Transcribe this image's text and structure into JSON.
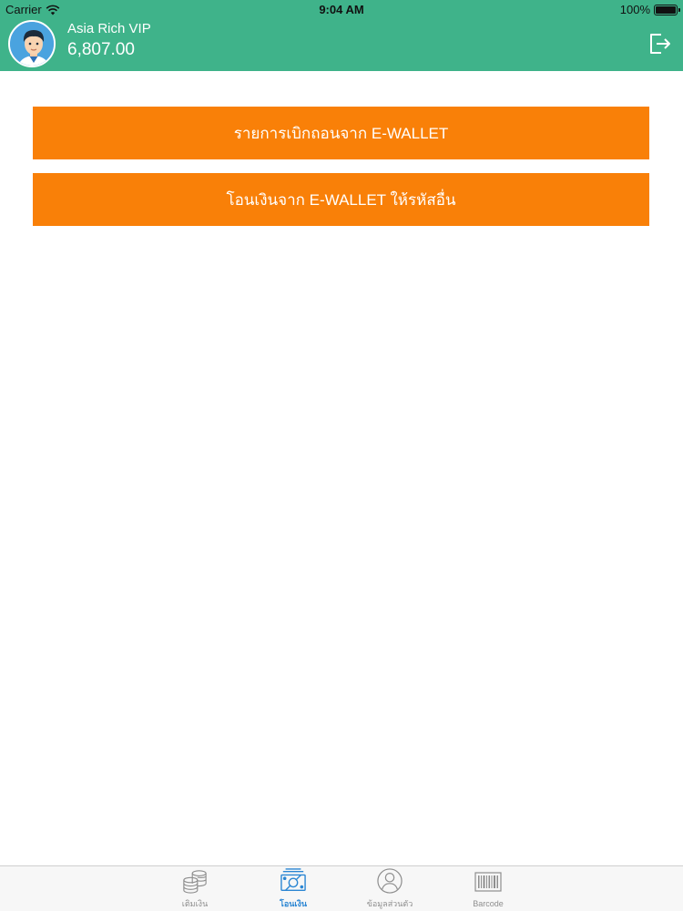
{
  "status_bar": {
    "carrier": "Carrier",
    "time": "9:04 AM",
    "battery": "100%"
  },
  "header": {
    "user_name": "Asia Rich VIP",
    "balance": "6,807.00",
    "logout_icon": "logout-icon",
    "background_color": "#3fb38a"
  },
  "actions": {
    "withdraw_list_label": "รายการเบิกถอนจาก E-WALLET",
    "transfer_label": "โอนเงินจาก E-WALLET ให้รหัสอื่น",
    "button_color": "#f98008"
  },
  "tabbar": {
    "tabs": [
      {
        "label": "เติมเงิน",
        "icon": "coins-icon",
        "active": false
      },
      {
        "label": "โอนเงิน",
        "icon": "money-icon",
        "active": true
      },
      {
        "label": "ข้อมูลส่วนตัว",
        "icon": "profile-icon",
        "active": false
      },
      {
        "label": "Barcode",
        "icon": "barcode-icon",
        "active": false
      }
    ],
    "active_color": "#2b86d3"
  }
}
